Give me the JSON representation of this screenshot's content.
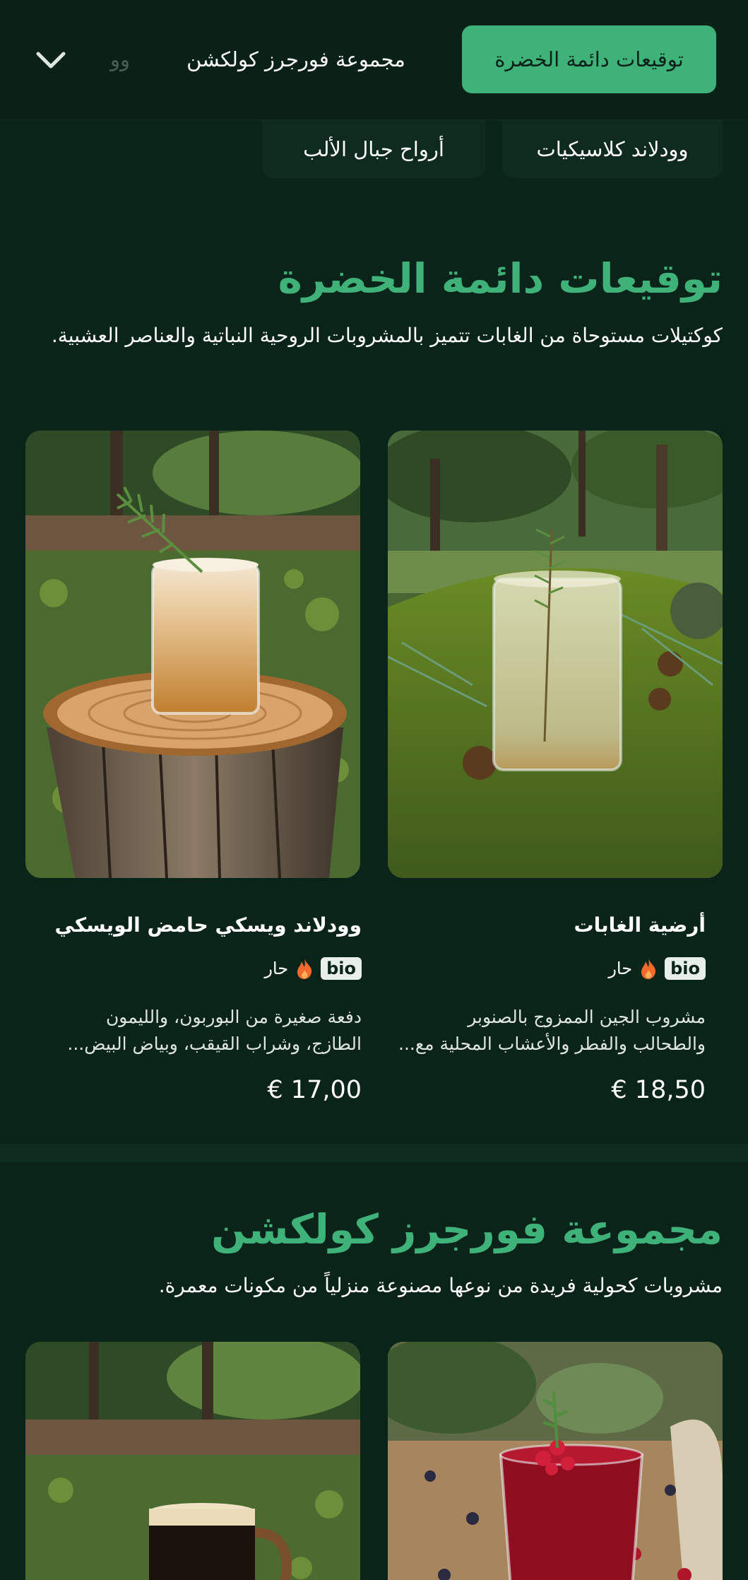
{
  "nav": {
    "tabs": [
      "توقيعات دائمة الخضرة",
      "مجموعة فورجرز كولكشن",
      "وو"
    ],
    "subtabs": [
      "وودلاند كلاسيكيات",
      "أرواح جبال الألب"
    ]
  },
  "sections": [
    {
      "title": "توقيعات دائمة الخضرة",
      "description": "كوكتيلات مستوحاة من الغابات تتميز بالمشروبات الروحية النباتية والعناصر العشبية.",
      "items": [
        {
          "name": "أرضية الغابات",
          "badge": "bio",
          "tag": "حار",
          "description": "مشروب الجين الممزوج بالصنوبر والطحالب والفطر والأعشاب المحلية مع...",
          "price": "18,50 €"
        },
        {
          "name": "وودلاند ويسكي حامض الويسكي",
          "badge": "bio",
          "tag": "حار",
          "description": "دفعة صغيرة من البوربون، والليمون الطازج، وشراب القيقب، وبياض البيض...",
          "price": "17,00 €"
        }
      ]
    },
    {
      "title": "مجموعة فورجرز كولكشن",
      "description": "مشروبات كحولية فريدة من نوعها مصنوعة منزلياً من مكونات معمرة."
    }
  ],
  "colors": {
    "background": "#0b2419",
    "accent": "#3fb27a",
    "hot": "#f26a2e"
  },
  "icons": [
    "chevron-down-icon",
    "flame-icon"
  ]
}
